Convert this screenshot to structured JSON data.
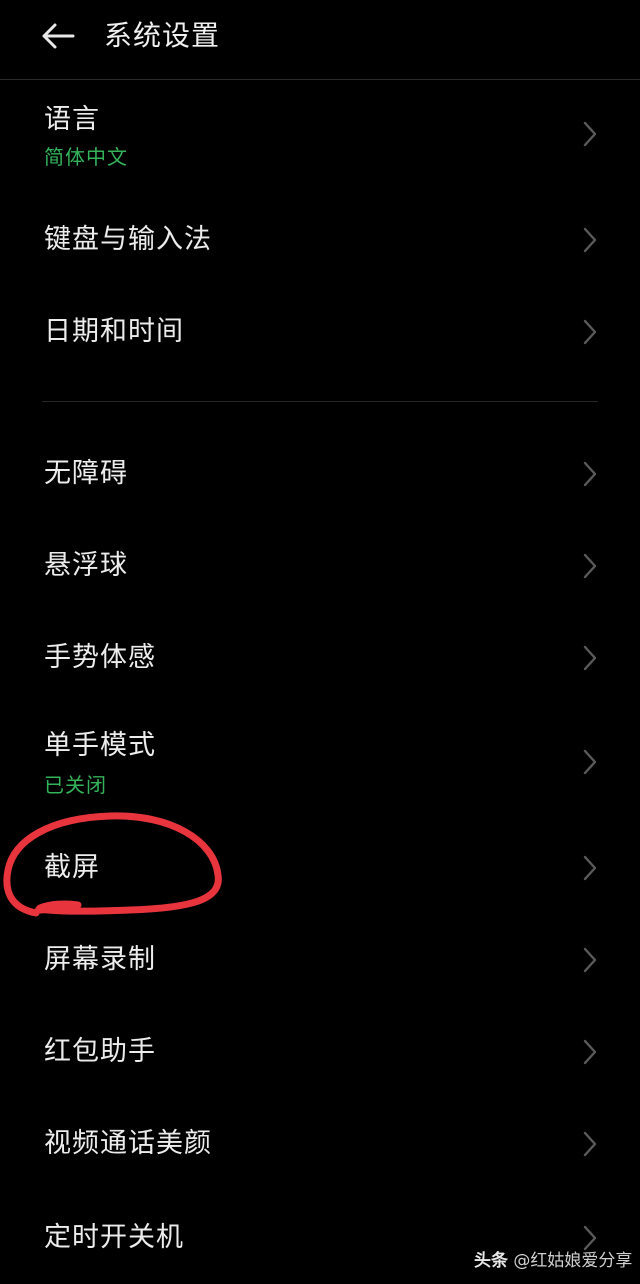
{
  "header": {
    "title": "系统设置",
    "back_icon": "arrow-left-icon"
  },
  "settings": {
    "language": {
      "label": "语言",
      "value": "简体中文"
    },
    "keyboard": {
      "label": "键盘与输入法"
    },
    "datetime": {
      "label": "日期和时间"
    },
    "accessibility": {
      "label": "无障碍"
    },
    "floating_ball": {
      "label": "悬浮球"
    },
    "gestures": {
      "label": "手势体感"
    },
    "one_hand": {
      "label": "单手模式",
      "value": "已关闭"
    },
    "screenshot": {
      "label": "截屏"
    },
    "screen_record": {
      "label": "屏幕录制"
    },
    "red_packet": {
      "label": "红包助手"
    },
    "video_beauty": {
      "label": "视频通话美颜"
    },
    "scheduled_power": {
      "label": "定时开关机"
    }
  },
  "watermark": {
    "brand": "头条",
    "handle": "@红姑娘爱分享"
  },
  "colors": {
    "background": "#000000",
    "text": "#ececec",
    "accent_green": "#33b35a",
    "chevron": "#5a5a5a",
    "annotation_red": "#e8343c"
  }
}
